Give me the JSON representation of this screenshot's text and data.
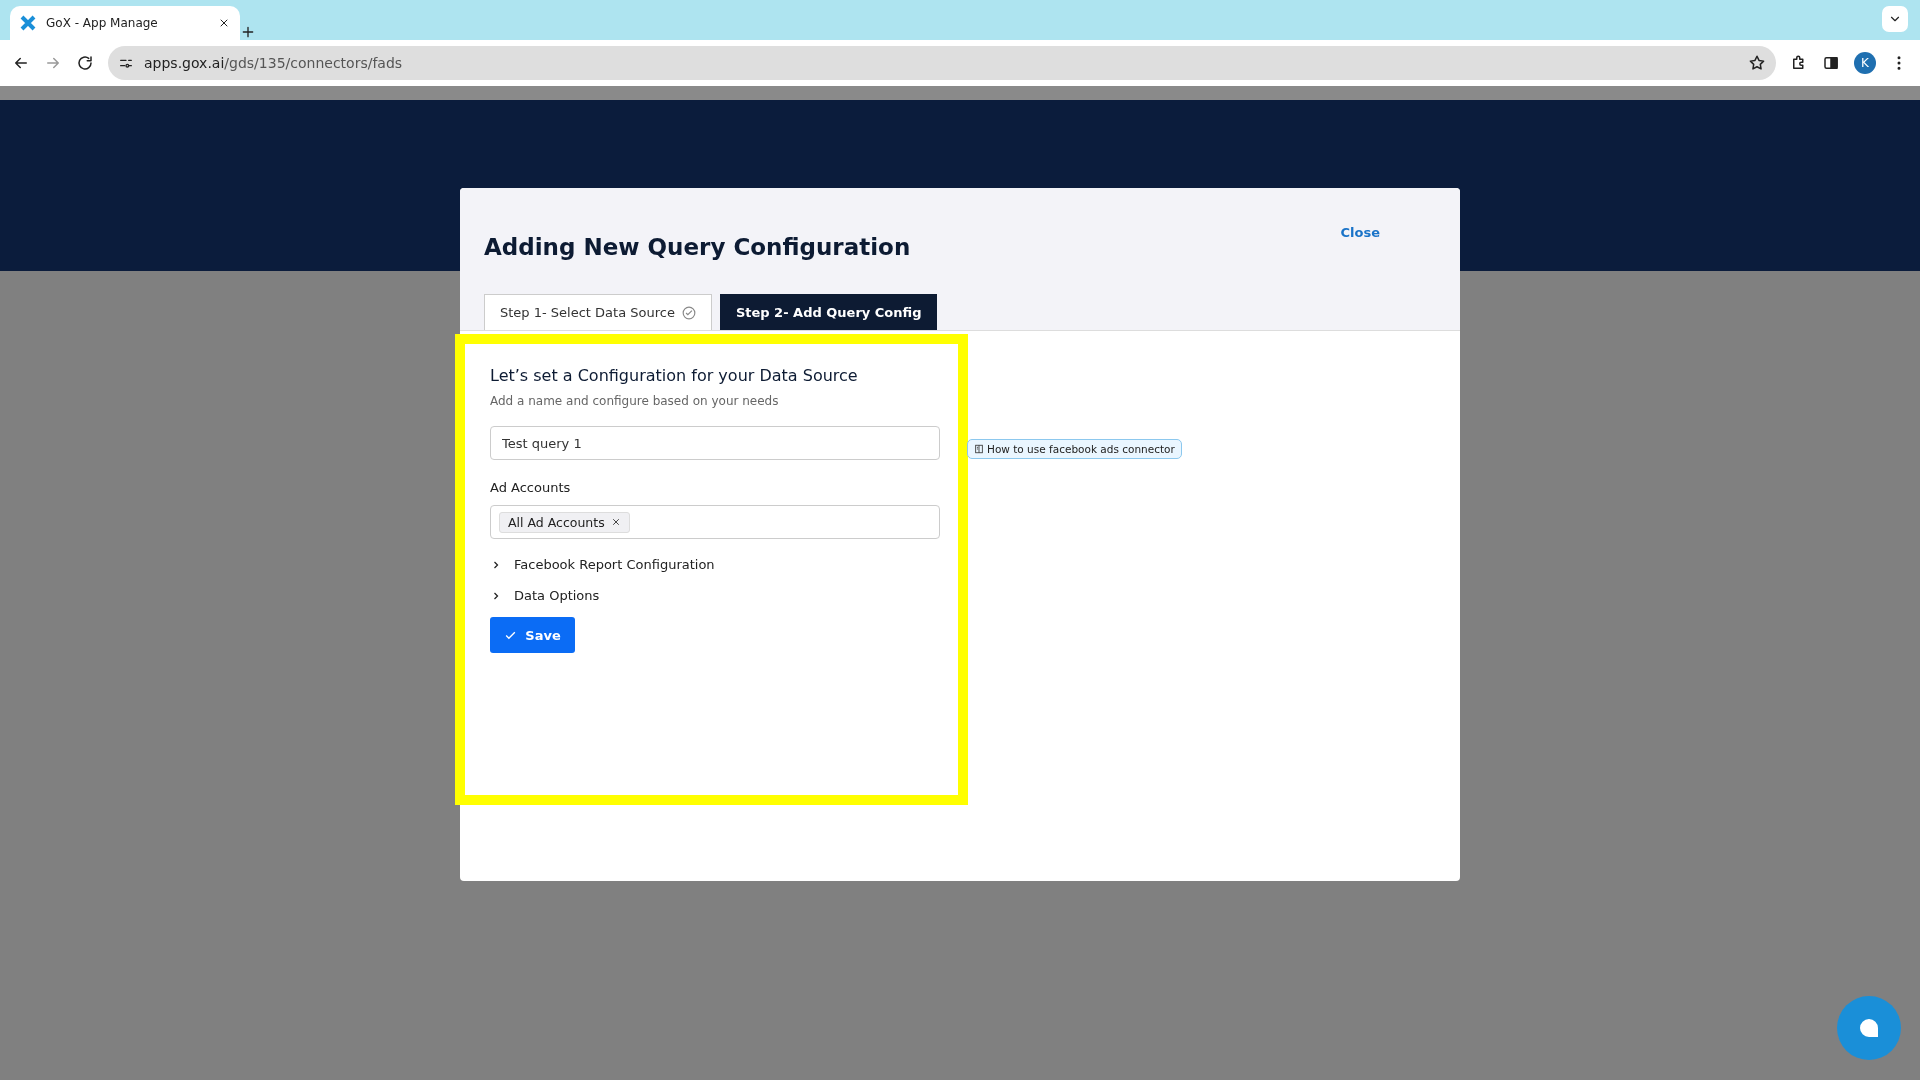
{
  "browser": {
    "tab_title": "GoX - App Manage",
    "url_host": "apps.gox.ai",
    "url_path": "/gds/135/connectors/fads",
    "avatar": "K"
  },
  "modal": {
    "title": "Adding New Query Configuration",
    "close": "Close",
    "steps": [
      {
        "label": "Step 1- Select Data Source",
        "selected": false,
        "completed": true
      },
      {
        "label": "Step 2- Add Query Config",
        "selected": true,
        "completed": false
      }
    ],
    "heading": "Let’s set a Configuration for your Data Source",
    "subheading": "Add a name and configure based on your needs",
    "name_field": {
      "value": "Test query 1"
    },
    "ad_accounts": {
      "label": "Ad Accounts",
      "tags": [
        {
          "label": "All Ad Accounts"
        }
      ]
    },
    "sections": [
      {
        "label": "Facebook Report Configuration",
        "expanded": false
      },
      {
        "label": "Data Options",
        "expanded": false
      }
    ],
    "save": "Save",
    "help_link": "How to use facebook ads connector"
  }
}
